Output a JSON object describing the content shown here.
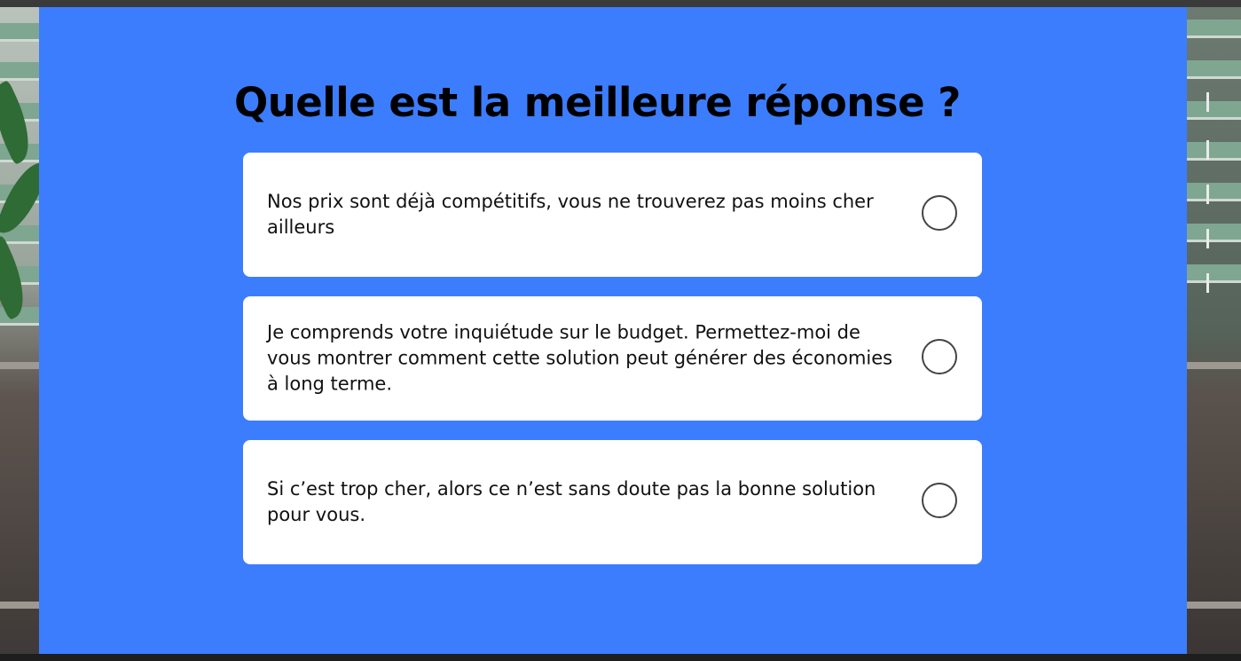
{
  "quiz": {
    "question": "Quelle est la meilleure réponse ?",
    "options": [
      {
        "label": "Nos prix sont déjà compétitifs, vous ne trouverez pas moins cher ailleurs",
        "selected": false
      },
      {
        "label": "Je comprends votre inquiétude sur le budget. Permettez-moi de vous montrer comment cette solution peut générer des économies à long terme.",
        "selected": false
      },
      {
        "label": "Si c’est trop cher, alors ce n’est sans doute pas la bonne solution pour vous.",
        "selected": false
      }
    ]
  },
  "colors": {
    "panel_background": "#3c7dfe",
    "card_background": "#ffffff",
    "title_text": "#000000",
    "radio_border": "#444444"
  },
  "icons": {
    "radio": "radio-unchecked-icon"
  }
}
